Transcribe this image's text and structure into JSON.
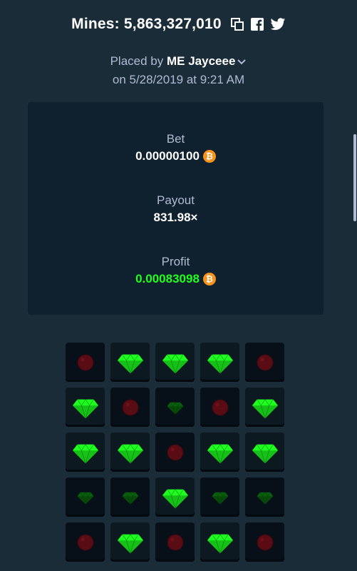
{
  "header": {
    "title": "Mines: 5,863,327,010",
    "icons": [
      "copy-icon",
      "facebook-icon",
      "twitter-icon"
    ]
  },
  "bet_info": {
    "placed_by_prefix": "Placed by",
    "username": "ME Jayceee",
    "date_line": "on 5/28/2019 at 9:21 AM"
  },
  "stats": {
    "bet_label": "Bet",
    "bet_value": "0.00000100",
    "payout_label": "Payout",
    "payout_value": "831.98×",
    "profit_label": "Profit",
    "profit_value": "0.00083098",
    "currency_icon": "bitcoin-icon",
    "currency_glyph": "₿"
  },
  "colors": {
    "background": "#1a2c38",
    "panel": "#0f212e",
    "profit_green": "#1fff20",
    "gem_bright": "#1fff20",
    "gem_dim": "#0a5f0d",
    "mine_dim": "#5a0c14",
    "bitcoin": "#f7931a"
  },
  "board": {
    "rows": [
      [
        "mine",
        "gem-picked",
        "gem-picked",
        "gem-picked",
        "mine"
      ],
      [
        "gem-picked",
        "mine",
        "gem",
        "mine",
        "gem-picked"
      ],
      [
        "gem-picked",
        "gem-picked",
        "mine",
        "gem-picked",
        "gem-picked"
      ],
      [
        "gem",
        "gem",
        "gem-picked",
        "gem",
        "gem"
      ],
      [
        "mine",
        "gem-picked",
        "mine",
        "gem-picked",
        "mine"
      ]
    ]
  }
}
